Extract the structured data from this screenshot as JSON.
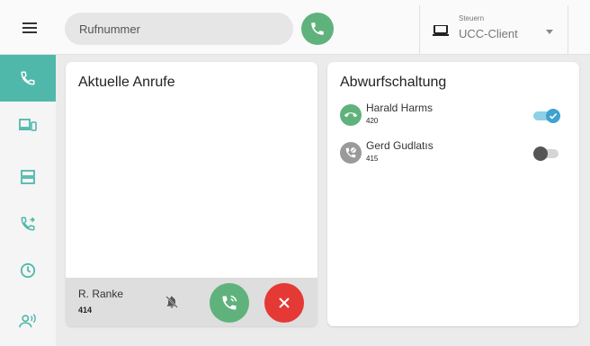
{
  "header": {
    "search": {
      "placeholder": "Rufnummer",
      "value": ""
    },
    "control": {
      "label": "Steuern",
      "value": "UCC-Client"
    }
  },
  "sidebar": {
    "items": [
      {
        "icon": "phone-icon",
        "active": true
      },
      {
        "icon": "devices-icon",
        "active": false
      },
      {
        "icon": "storage-icon",
        "active": false
      },
      {
        "icon": "call-forward-icon",
        "active": false
      },
      {
        "icon": "clock-icon",
        "active": false
      },
      {
        "icon": "person-voice-icon",
        "active": false
      }
    ]
  },
  "current_calls": {
    "title": "Aktuelle Anrufe",
    "call": {
      "name": "R. Ranke",
      "number": "414"
    }
  },
  "deflection": {
    "title": "Abwurfschaltung",
    "entries": [
      {
        "name": "Harald Harms",
        "number": "420",
        "enabled": true
      },
      {
        "name": "Gerd Gudlatıs",
        "number": "415",
        "enabled": false
      }
    ]
  },
  "colors": {
    "accent": "#4fb8ab",
    "call_green": "#5fb27b",
    "reject_red": "#e53935",
    "toggle_blue": "#3fa2cf"
  }
}
